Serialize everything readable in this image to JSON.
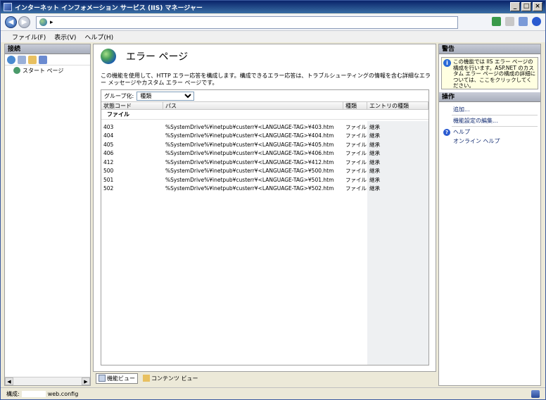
{
  "window": {
    "title": "インターネット インフォメーション サービス (IIS) マネージャー",
    "min_label": "_",
    "max_label": "□",
    "close_label": "×"
  },
  "address": {
    "back": "◀",
    "forward": "▶",
    "path_sep": "▸"
  },
  "menu": {
    "file": "ファイル(F)",
    "view": "表示(V)",
    "help": "ヘルプ(H)"
  },
  "connections": {
    "header": "接続",
    "tree": [
      {
        "label": "スタート ページ"
      }
    ]
  },
  "main": {
    "title": "エラー ページ",
    "description": "この機能を使用して、HTTP エラー応答を構成します。構成できるエラー応答は、トラブルシューティングの情報を含む詳細なエラー メッセージやカスタム エラー ページです。",
    "group_by_label": "グループ化:",
    "group_by_value": "種類",
    "columns": [
      "状態コード",
      "パス",
      "種類",
      "エントリの種類"
    ],
    "group_name": "ファイル",
    "rows": [
      {
        "code": "403",
        "path": "%SystemDrive%¥inetpub¥custerr¥<LANGUAGE-TAG>¥403.htm",
        "type": "ファイル",
        "entry": "継承"
      },
      {
        "code": "404",
        "path": "%SystemDrive%¥inetpub¥custerr¥<LANGUAGE-TAG>¥404.htm",
        "type": "ファイル",
        "entry": "継承"
      },
      {
        "code": "405",
        "path": "%SystemDrive%¥inetpub¥custerr¥<LANGUAGE-TAG>¥405.htm",
        "type": "ファイル",
        "entry": "継承"
      },
      {
        "code": "406",
        "path": "%SystemDrive%¥inetpub¥custerr¥<LANGUAGE-TAG>¥406.htm",
        "type": "ファイル",
        "entry": "継承"
      },
      {
        "code": "412",
        "path": "%SystemDrive%¥inetpub¥custerr¥<LANGUAGE-TAG>¥412.htm",
        "type": "ファイル",
        "entry": "継承"
      },
      {
        "code": "500",
        "path": "%SystemDrive%¥inetpub¥custerr¥<LANGUAGE-TAG>¥500.htm",
        "type": "ファイル",
        "entry": "継承"
      },
      {
        "code": "501",
        "path": "%SystemDrive%¥inetpub¥custerr¥<LANGUAGE-TAG>¥501.htm",
        "type": "ファイル",
        "entry": "継承"
      },
      {
        "code": "502",
        "path": "%SystemDrive%¥inetpub¥custerr¥<LANGUAGE-TAG>¥502.htm",
        "type": "ファイル",
        "entry": "継承"
      }
    ],
    "view_tabs": {
      "features": "機能ビュー",
      "content": "コンテンツ ビュー"
    }
  },
  "alerts": {
    "header": "警告",
    "message": "この機能では IIS エラー ページの構成を行います。ASP.NET のカスタム エラー ページの構成の詳細については、ここをクリックしてください。"
  },
  "actions": {
    "header": "操作",
    "add": "追加...",
    "edit_settings": "機能設定の編集...",
    "help": "ヘルプ",
    "online_help": "オンライン ヘルプ"
  },
  "status": {
    "prefix": "構成:",
    "file": "web.config"
  },
  "colors": {
    "title_start": "#0a246a",
    "title_end": "#3a6ea5",
    "link": "#102a70"
  }
}
